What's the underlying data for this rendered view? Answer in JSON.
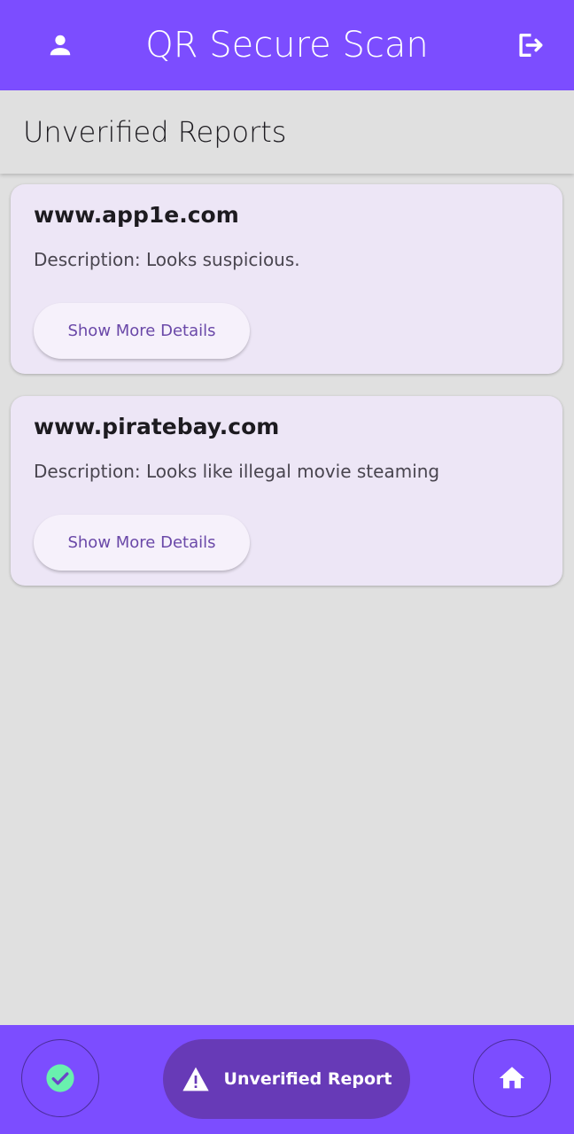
{
  "app_bar": {
    "title": "QR Secure Scan",
    "left_icon": "person-icon",
    "right_icon": "logout-icon"
  },
  "page": {
    "heading": "Unverified Reports"
  },
  "reports": [
    {
      "url": "www.app1e.com",
      "description": "Description: Looks suspicious.",
      "button_label": "Show More Details"
    },
    {
      "url": "www.piratebay.com",
      "description": "Description: Looks like illegal movie steaming",
      "button_label": "Show More Details"
    }
  ],
  "bottom_nav": {
    "left_icon": "check-circle-icon",
    "active_label": "Unverified Report",
    "active_icon": "warning-icon",
    "right_icon": "home-icon"
  },
  "colors": {
    "primary": "#7c4dff",
    "active_nav": "#673ab7",
    "card_bg": "#ede6f6",
    "check_green": "#69f0ae",
    "background": "#e0e0e0"
  }
}
